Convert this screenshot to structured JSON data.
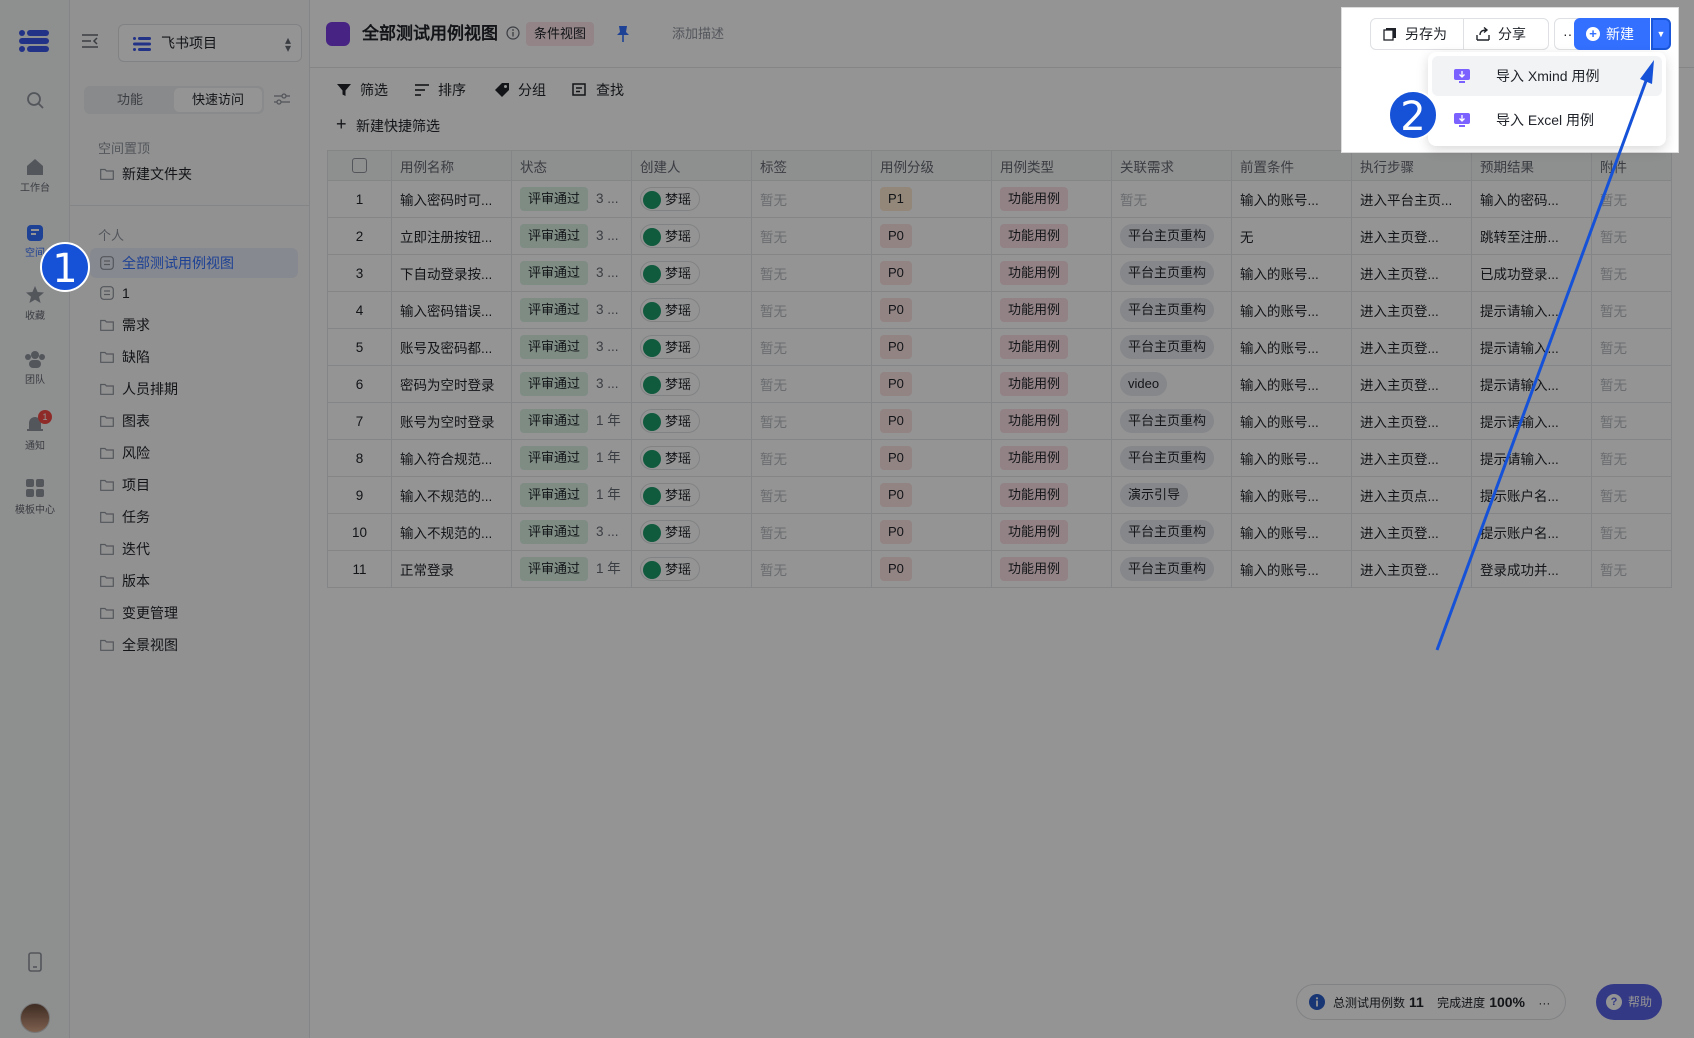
{
  "rail": {
    "items": [
      {
        "label": "工作台"
      },
      {
        "label": "空间"
      },
      {
        "label": "收藏"
      },
      {
        "label": "团队"
      },
      {
        "label": "通知",
        "badge": "1"
      },
      {
        "label": "模板中心"
      }
    ]
  },
  "sidebar": {
    "project": "飞书项目",
    "tabs": {
      "feature": "功能",
      "quick": "快速访问"
    },
    "pinned_section": "空间置顶",
    "pinned_items": [
      "新建文件夹"
    ],
    "personal_section": "个人",
    "items": [
      "全部测试用例视图",
      "1",
      "需求",
      "缺陷",
      "人员排期",
      "图表",
      "风险",
      "项目",
      "任务",
      "迭代",
      "版本",
      "变更管理",
      "全景视图"
    ]
  },
  "header": {
    "title": "全部测试用例视图",
    "view_type": "条件视图",
    "add_desc": "添加描述",
    "save_as": "另存为",
    "share": "分享",
    "more": "···",
    "new": "新建"
  },
  "toolbar": {
    "filter": "筛选",
    "sort": "排序",
    "group": "分组",
    "find": "查找",
    "quick_filter": "新建快捷筛选"
  },
  "dropdown": {
    "import_xmind": "导入 Xmind 用例",
    "import_excel": "导入 Excel 用例"
  },
  "table": {
    "columns": [
      "用例名称",
      "状态",
      "创建人",
      "标签",
      "用例分级",
      "用例类型",
      "关联需求",
      "前置条件",
      "执行步骤",
      "预期结果",
      "附件"
    ],
    "rows": [
      {
        "no": "1",
        "name": "输入密码时可...",
        "status": "评审通过",
        "time": "3 ...",
        "creator": "梦瑶",
        "tag": "暂无",
        "level": "P1",
        "type": "功能用例",
        "req": "暂无",
        "pre": "输入的账号...",
        "steps": "进入平台主页...",
        "expect": "输入的密码...",
        "attach": "暂无"
      },
      {
        "no": "2",
        "name": "立即注册按钮...",
        "status": "评审通过",
        "time": "3 ...",
        "creator": "梦瑶",
        "tag": "暂无",
        "level": "P0",
        "type": "功能用例",
        "req": "平台主页重构",
        "pre": "无",
        "steps": "进入主页登...",
        "expect": "跳转至注册...",
        "attach": "暂无"
      },
      {
        "no": "3",
        "name": "下自动登录按...",
        "status": "评审通过",
        "time": "3 ...",
        "creator": "梦瑶",
        "tag": "暂无",
        "level": "P0",
        "type": "功能用例",
        "req": "平台主页重构",
        "pre": "输入的账号...",
        "steps": "进入主页登...",
        "expect": "已成功登录...",
        "attach": "暂无"
      },
      {
        "no": "4",
        "name": "输入密码错误...",
        "status": "评审通过",
        "time": "3 ...",
        "creator": "梦瑶",
        "tag": "暂无",
        "level": "P0",
        "type": "功能用例",
        "req": "平台主页重构",
        "pre": "输入的账号...",
        "steps": "进入主页登...",
        "expect": "提示请输入...",
        "attach": "暂无"
      },
      {
        "no": "5",
        "name": "账号及密码都...",
        "status": "评审通过",
        "time": "3 ...",
        "creator": "梦瑶",
        "tag": "暂无",
        "level": "P0",
        "type": "功能用例",
        "req": "平台主页重构",
        "pre": "输入的账号...",
        "steps": "进入主页登...",
        "expect": "提示请输入...",
        "attach": "暂无"
      },
      {
        "no": "6",
        "name": "密码为空时登录",
        "status": "评审通过",
        "time": "3 ...",
        "creator": "梦瑶",
        "tag": "暂无",
        "level": "P0",
        "type": "功能用例",
        "req": "video",
        "pre": "输入的账号...",
        "steps": "进入主页登...",
        "expect": "提示请输入...",
        "attach": "暂无"
      },
      {
        "no": "7",
        "name": "账号为空时登录",
        "status": "评审通过",
        "time": "1 年",
        "creator": "梦瑶",
        "tag": "暂无",
        "level": "P0",
        "type": "功能用例",
        "req": "平台主页重构",
        "pre": "输入的账号...",
        "steps": "进入主页登...",
        "expect": "提示请输入...",
        "attach": "暂无"
      },
      {
        "no": "8",
        "name": "输入符合规范...",
        "status": "评审通过",
        "time": "1 年",
        "creator": "梦瑶",
        "tag": "暂无",
        "level": "P0",
        "type": "功能用例",
        "req": "平台主页重构",
        "pre": "输入的账号...",
        "steps": "进入主页登...",
        "expect": "提示请输入...",
        "attach": "暂无"
      },
      {
        "no": "9",
        "name": "输入不规范的...",
        "status": "评审通过",
        "time": "1 年",
        "creator": "梦瑶",
        "tag": "暂无",
        "level": "P0",
        "type": "功能用例",
        "req": "演示引导",
        "pre": "输入的账号...",
        "steps": "进入主页点...",
        "expect": "提示账户名...",
        "attach": "暂无"
      },
      {
        "no": "10",
        "name": "输入不规范的...",
        "status": "评审通过",
        "time": "3 ...",
        "creator": "梦瑶",
        "tag": "暂无",
        "level": "P0",
        "type": "功能用例",
        "req": "平台主页重构",
        "pre": "输入的账号...",
        "steps": "进入主页登...",
        "expect": "提示账户名...",
        "attach": "暂无"
      },
      {
        "no": "11",
        "name": "正常登录",
        "status": "评审通过",
        "time": "1 年",
        "creator": "梦瑶",
        "tag": "暂无",
        "level": "P0",
        "type": "功能用例",
        "req": "平台主页重构",
        "pre": "输入的账号...",
        "steps": "进入主页登...",
        "expect": "登录成功并...",
        "attach": "暂无"
      }
    ]
  },
  "footer": {
    "total_label": "总测试用例数",
    "total": "11",
    "progress_label": "完成进度",
    "progress": "100%",
    "help": "帮助"
  },
  "annotations": {
    "step1": "1",
    "step2": "2"
  },
  "colors": {
    "accent": "#3370ff",
    "annotation": "#1552d8"
  }
}
